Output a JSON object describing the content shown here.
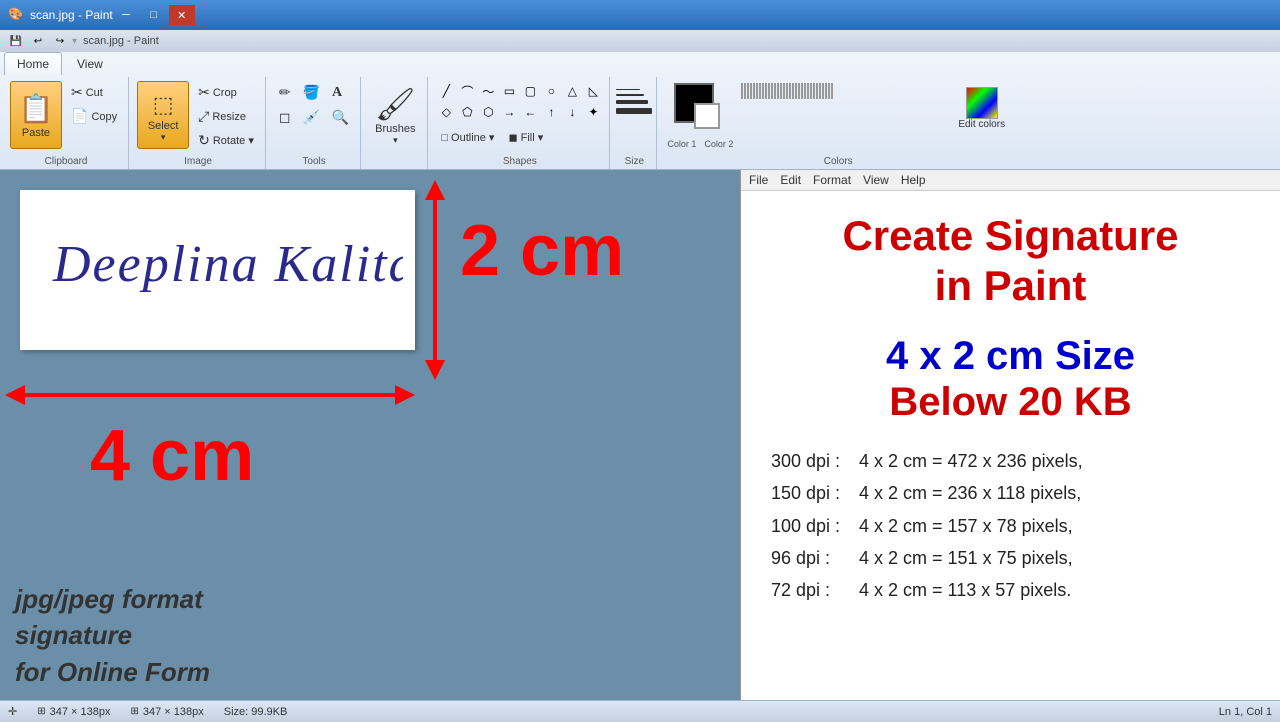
{
  "window": {
    "title": "scan.jpg - Paint",
    "titlebar_btns": [
      "─",
      "□",
      "✕"
    ]
  },
  "quickaccess": {
    "btns": [
      "💾",
      "↩",
      "↪",
      "▾"
    ]
  },
  "ribbon": {
    "tabs": [
      "Home",
      "View"
    ],
    "active_tab": "Home",
    "groups": {
      "clipboard": {
        "label": "Clipboard",
        "paste": "Paste",
        "cut": "Cut",
        "copy": "Copy"
      },
      "image": {
        "label": "Image",
        "crop": "Crop",
        "resize": "Resize",
        "rotate": "Rotate ▾",
        "select": "Select"
      },
      "tools": {
        "label": "Tools"
      },
      "brushes": {
        "label": "Brushes"
      },
      "shapes": {
        "label": "Shapes"
      },
      "size": {
        "label": "Size"
      },
      "colors": {
        "label": "Colors",
        "color1": "Color 1",
        "color2": "Color 2",
        "edit": "Edit colors"
      }
    }
  },
  "canvas": {
    "signature_text": "Deeplina  Kalita",
    "measure_v": "2 cm",
    "measure_h": "4 cm",
    "format_line1": "jpg/jpeg format",
    "format_line2": "signature",
    "format_line3": "for Online Form"
  },
  "right_panel": {
    "menu": [
      "File",
      "Edit",
      "Format",
      "View",
      "Help"
    ],
    "title_line1": "Create Signature",
    "title_line2": "in Paint",
    "size_line": "4 x 2 cm Size",
    "kb_line": "Below 20 KB",
    "dpi_rows": [
      {
        "dpi": "300 dpi :",
        "value": "4 x 2 cm = 472 x 236 pixels,"
      },
      {
        "dpi": "150 dpi :",
        "value": "4 x 2 cm = 236 x 118 pixels,"
      },
      {
        "dpi": "100 dpi :",
        "value": "4 x 2 cm = 157 x 78 pixels,"
      },
      {
        "dpi": "96 dpi :",
        "value": "4 x 2 cm = 151 x 75 pixels,"
      },
      {
        "dpi": "72 dpi :",
        "value": "4 x 2 cm =  113 x 57 pixels."
      }
    ]
  },
  "status": {
    "cursor": "+",
    "selection": "347 × 138px",
    "canvas_size": "347 × 138px",
    "file_size": "Size: 99.9KB",
    "position": "Ln 1, Col 1"
  },
  "colors": {
    "color1_bg": "#000000",
    "color2_bg": "#ffffff",
    "palette": [
      "#000000",
      "#808080",
      "#800000",
      "#808000",
      "#008000",
      "#008080",
      "#000080",
      "#800080",
      "#804000",
      "#808040",
      "#ffffff",
      "#c0c0c0",
      "#ff0000",
      "#ffff00",
      "#00ff00",
      "#00ffff",
      "#0000ff",
      "#ff00ff",
      "#ff8040",
      "#ffff80",
      "#c0c0ff",
      "#ffc0ff",
      "#ff8080",
      "#ffe0c0",
      "#ffffe0",
      "#e0ffe0",
      "#c0ffc0",
      "#c0ffff",
      "#e0c0ff",
      "#ffd700",
      "#808080",
      "#404040",
      "#804040",
      "#808040",
      "#408040",
      "#408080",
      "#404080",
      "#804080",
      "#804820",
      "#606020"
    ]
  }
}
